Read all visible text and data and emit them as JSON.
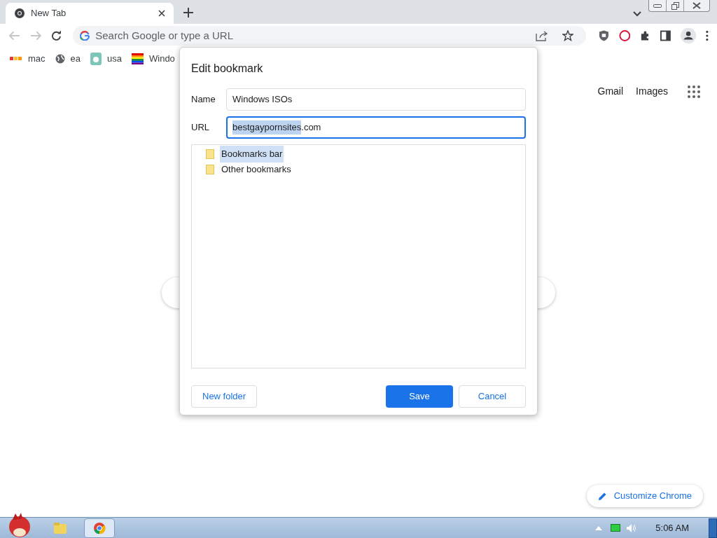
{
  "tab": {
    "title": "New Tab"
  },
  "omnibox": {
    "placeholder": "Search Google or type a URL"
  },
  "bookmarks_bar": [
    {
      "label": "mac",
      "kind": "multi"
    },
    {
      "label": "ea",
      "kind": "globe"
    },
    {
      "label": "usa",
      "kind": "app"
    },
    {
      "label": "Windo",
      "kind": "rainbow"
    }
  ],
  "ntp_links": [
    "Gmail",
    "Images"
  ],
  "customize": "Customize Chrome",
  "dialog": {
    "title": "Edit bookmark",
    "name_label": "Name",
    "name_value": "Windows ISOs",
    "url_label": "URL",
    "url_selected": "bestgaypornsites",
    "url_rest": ".com",
    "folders": [
      {
        "label": "Bookmarks bar",
        "selected": true
      },
      {
        "label": "Other bookmarks",
        "selected": false
      }
    ],
    "new_folder": "New folder",
    "save": "Save",
    "cancel": "Cancel"
  },
  "taskbar": {
    "time": "5:06 AM"
  }
}
